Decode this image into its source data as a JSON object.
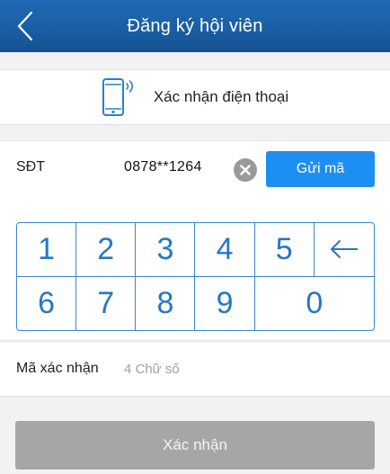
{
  "header": {
    "title": "Đăng ký hội viên",
    "back_icon": "chevron-left-icon"
  },
  "verify": {
    "label": "Xác nhận điện thoại",
    "icon": "smartphone-signal-icon"
  },
  "phone": {
    "label": "SĐT",
    "value": "0878**1264",
    "clear_icon": "close-circle-icon",
    "send_button": "Gửi mã"
  },
  "keypad": {
    "keys": [
      "1",
      "2",
      "3",
      "4",
      "5",
      "6",
      "7",
      "8",
      "9",
      "0"
    ],
    "backspace_icon": "backspace-arrow-icon"
  },
  "code": {
    "label": "Mã xác nhận",
    "placeholder": "4 Chữ số",
    "value": ""
  },
  "submit": {
    "label": "Xác nhận"
  },
  "colors": {
    "header": "#1a5fa6",
    "accent": "#1e8ff2",
    "keypad": "#2777c3",
    "disabled_button": "#a6a6a6"
  }
}
